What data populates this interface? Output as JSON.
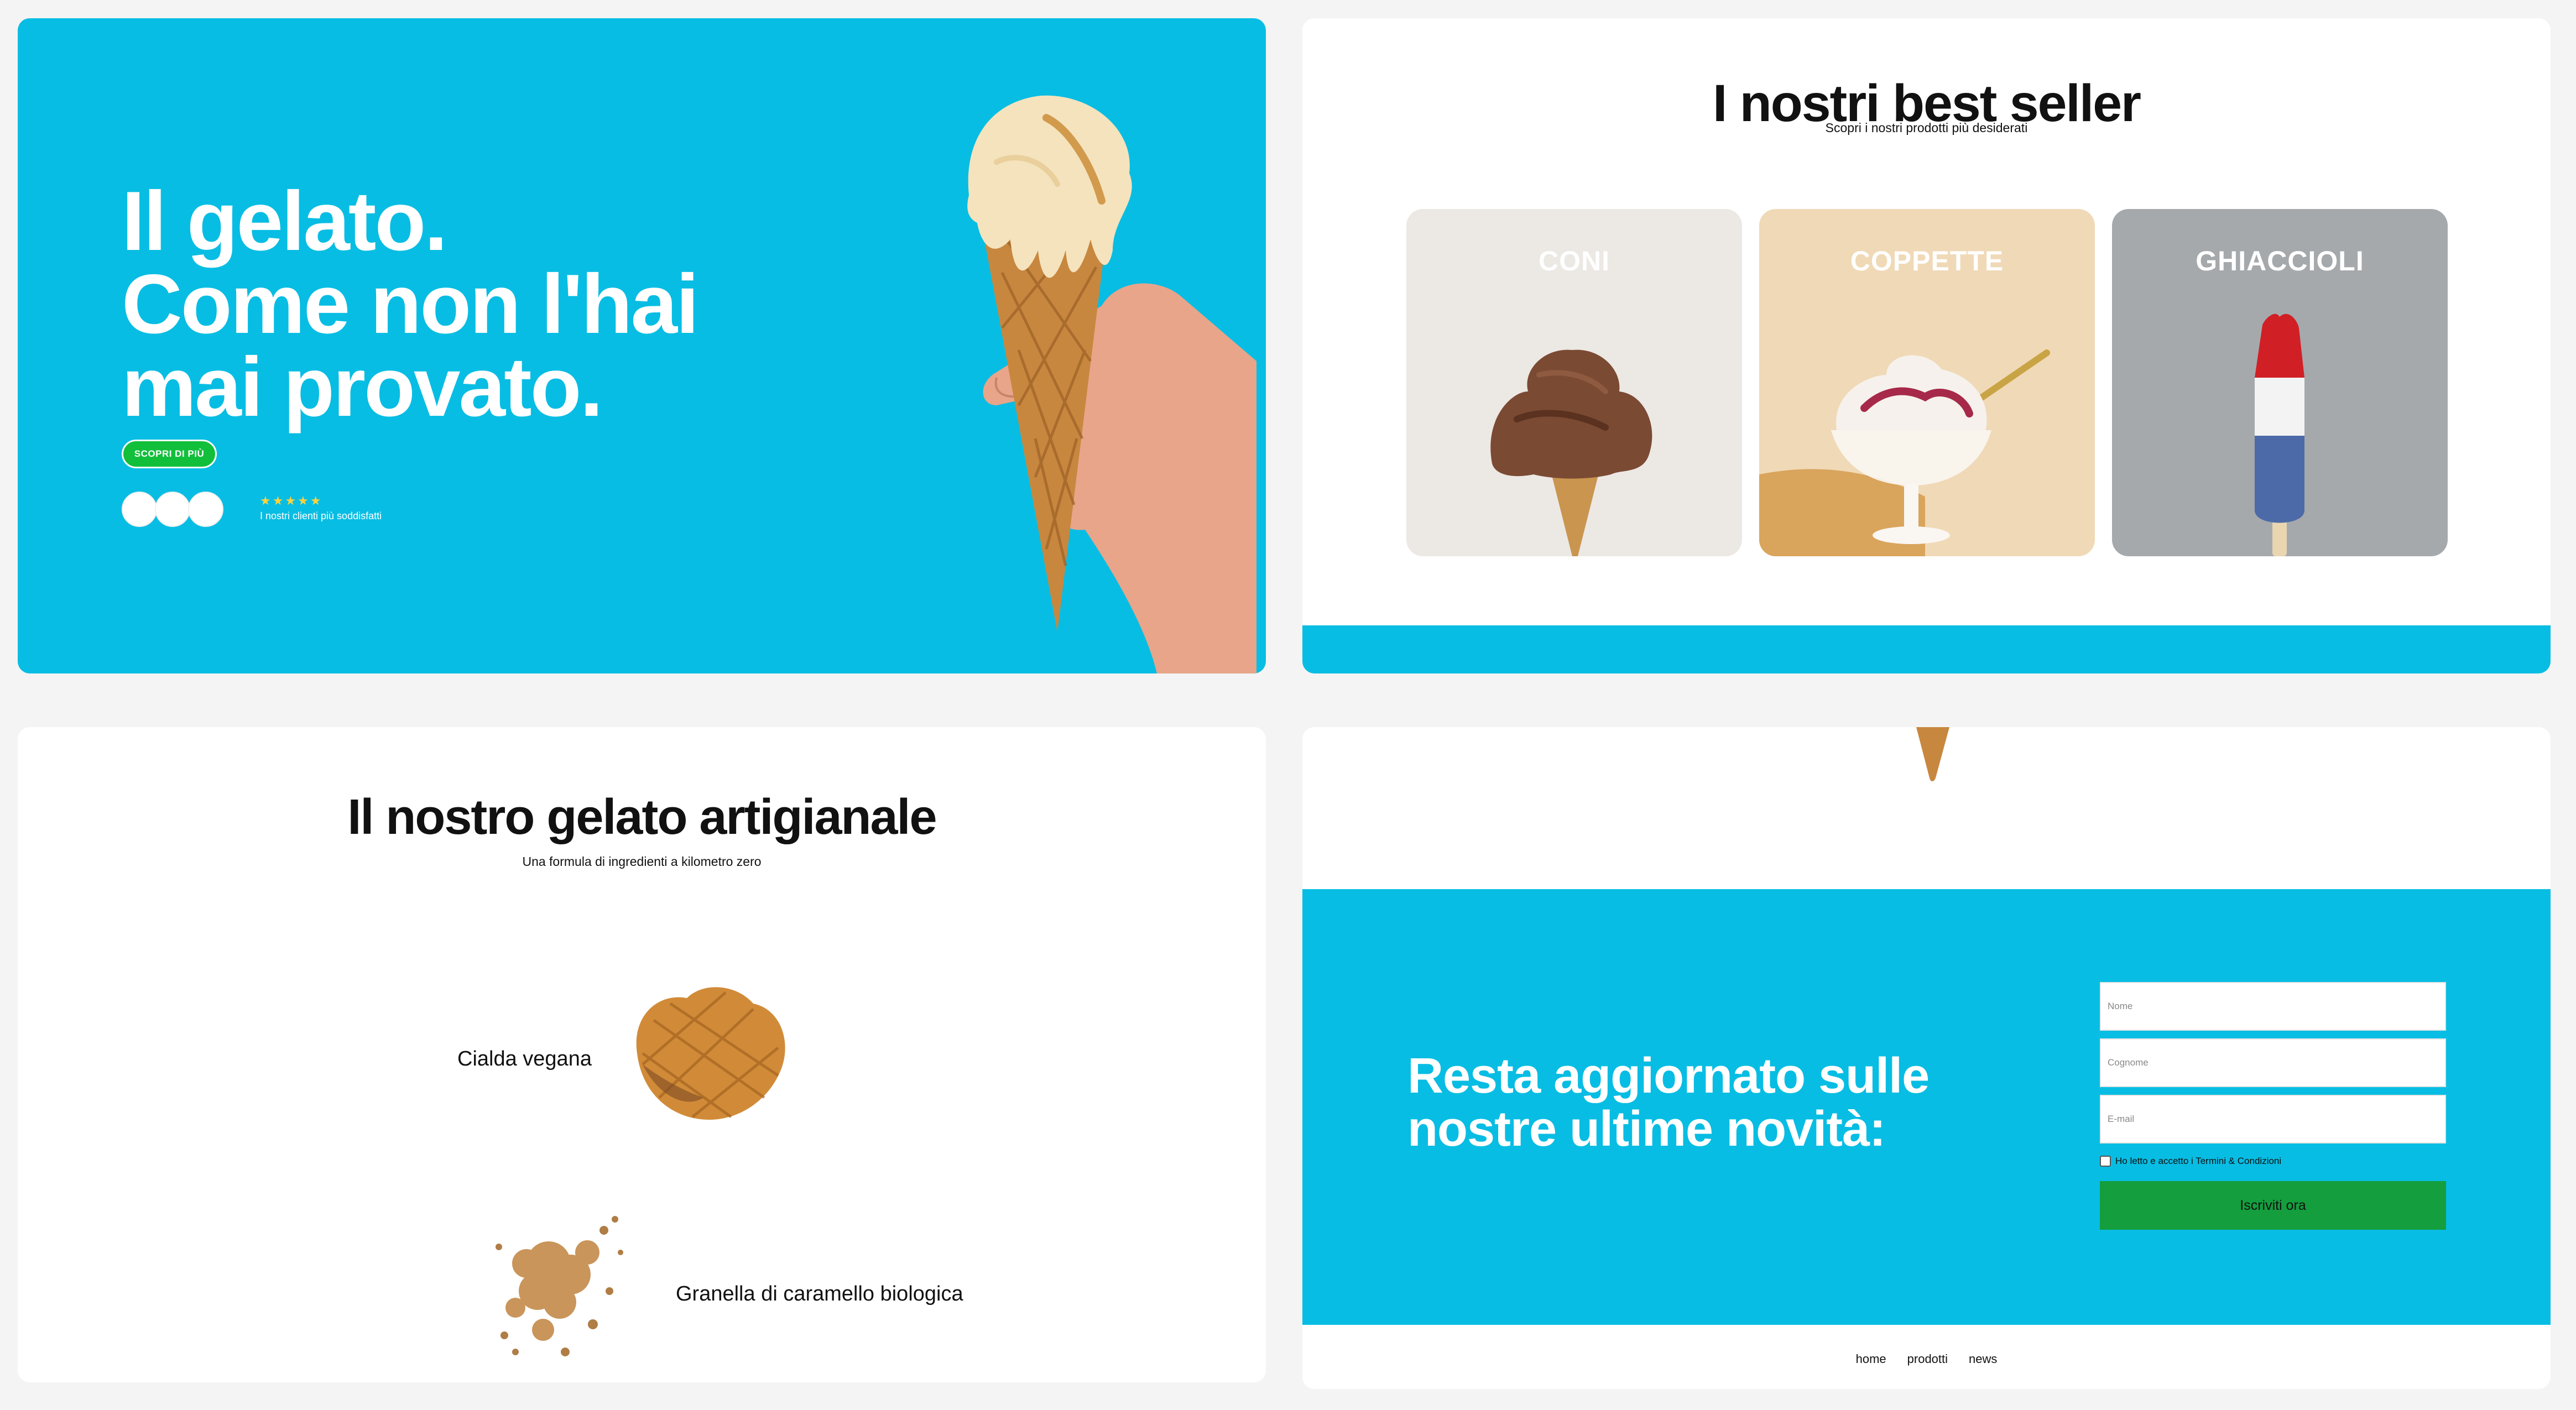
{
  "hero": {
    "title": "Il gelato.\nCome non l'hai\nmai provato.",
    "cta_label": "SCOPRI DI PIÙ",
    "stars": "★★★★★",
    "clients_text": "I nostri clienti più soddisfatti"
  },
  "bestseller": {
    "title": "I nostri best seller",
    "subtitle": "Scopri i nostri prodotti più desiderati",
    "cards": [
      {
        "label": "CONI"
      },
      {
        "label": "COPPETTE"
      },
      {
        "label": "GHIACCIOLI"
      }
    ]
  },
  "artigianale": {
    "title": "Il nostro gelato artigianale",
    "subtitle": "Una formula di ingredienti a kilometro zero",
    "ingredients": [
      {
        "label": "Cialda vegana"
      },
      {
        "label": "Granella di\ncaramello biologica"
      }
    ]
  },
  "newsletter": {
    "title": "Resta aggiornato sulle\nnostre ultime novità:",
    "fields": {
      "nome_placeholder": "Nome",
      "cognome_placeholder": "Cognome",
      "email_placeholder": "E-mail"
    },
    "terms_label": "Ho letto e accetto i Termini & Condizioni",
    "submit_label": "Iscriviti ora"
  },
  "footer": {
    "links": [
      "home",
      "prodotti",
      "news"
    ]
  },
  "colors": {
    "accent_blue": "#08bde3",
    "cta_green": "#12bf3b",
    "submit_green": "#149e3e",
    "page_background": "#f4f4f4"
  }
}
